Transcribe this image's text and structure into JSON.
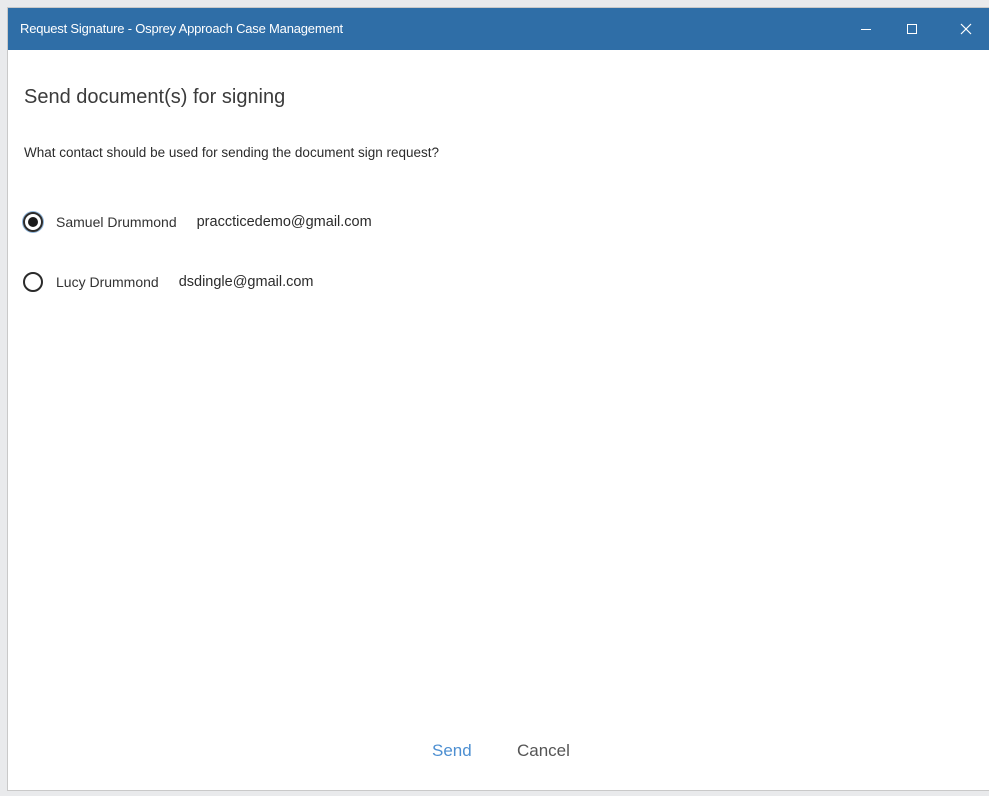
{
  "window": {
    "title": "Request Signature - Osprey Approach Case Management",
    "titlebar_color": "#2f6ea7",
    "controls": [
      "minimize-icon",
      "maximize-icon",
      "close-icon"
    ]
  },
  "dialog": {
    "heading": "Send document(s) for signing",
    "question": "What contact should be used for sending the document sign request?",
    "contacts": [
      {
        "name": "Samuel Drummond",
        "email": "praccticedemo@gmail.com",
        "selected": true
      },
      {
        "name": "Lucy Drummond",
        "email": "dsdingle@gmail.com",
        "selected": false
      }
    ]
  },
  "actions": {
    "send_label": "Send",
    "cancel_label": "Cancel",
    "accent_color": "#4d8fd1"
  }
}
